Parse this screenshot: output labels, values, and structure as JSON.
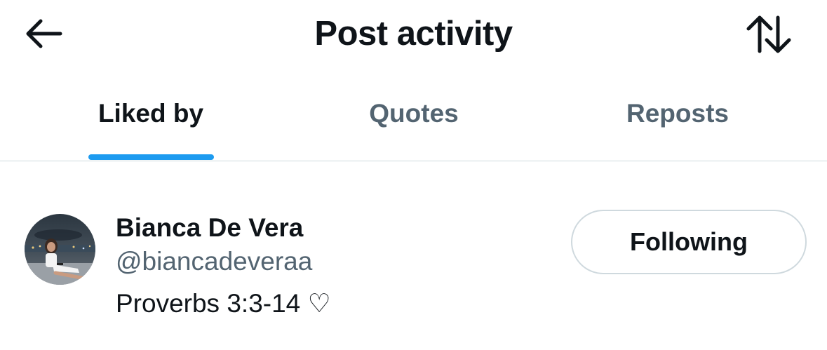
{
  "header": {
    "title": "Post activity",
    "back_icon": "arrow-left-icon",
    "sort_icon": "sort-arrows-icon"
  },
  "tabs": [
    {
      "label": "Liked by",
      "active": true
    },
    {
      "label": "Quotes",
      "active": false
    },
    {
      "label": "Reposts",
      "active": false
    }
  ],
  "colors": {
    "accent": "#1d9bf0",
    "text_primary": "#0f1419",
    "text_secondary": "#536471",
    "divider": "#cfd9de"
  },
  "users": [
    {
      "name": "Bianca De Vera",
      "handle": "@biancadeveraa",
      "bio": "Proverbs 3:3-14 ♡",
      "follow_label": "Following"
    }
  ]
}
